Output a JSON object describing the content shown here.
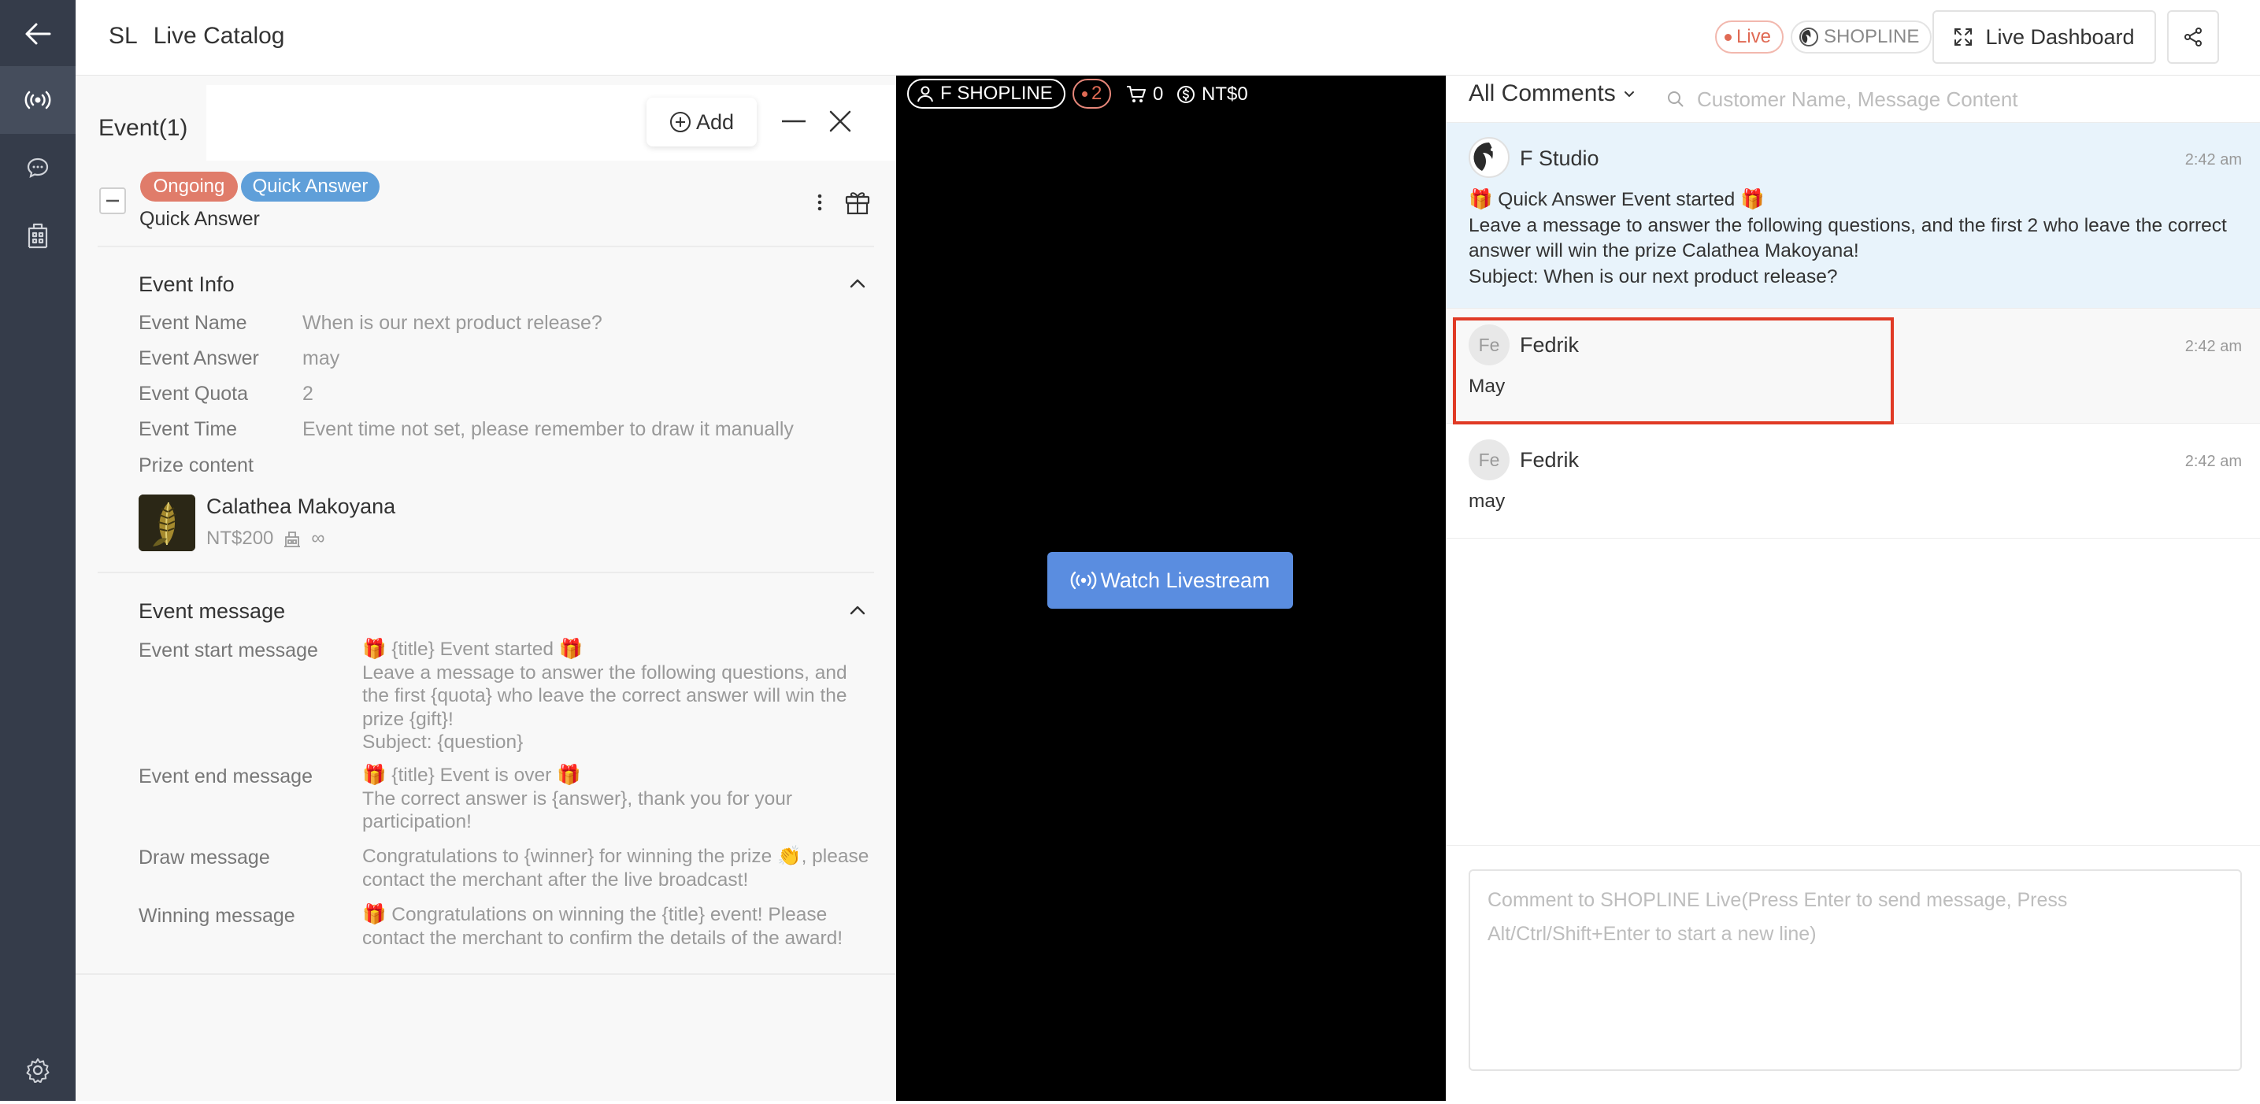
{
  "header": {
    "app_code": "SL",
    "app_title": "Live Catalog",
    "live_badge": "Live",
    "brand_badge": "SHOPLINE",
    "dashboard_button": "Live Dashboard"
  },
  "event_panel": {
    "tab_label": "Event(1)",
    "add_button": "Add",
    "event": {
      "status_tag": "Ongoing",
      "type_tag": "Quick Answer",
      "type_name": "Quick Answer",
      "info_section_title": "Event Info",
      "fields": [
        {
          "label": "Event Name",
          "value": "When is our next product release?"
        },
        {
          "label": "Event Answer",
          "value": "may"
        },
        {
          "label": "Event Quota",
          "value": "2"
        },
        {
          "label": "Event Time",
          "value": "Event time not set, please remember to draw it manually"
        }
      ],
      "prize_label": "Prize content",
      "prize": {
        "name": "Calathea Makoyana",
        "price": "NT$200",
        "stock": "∞"
      },
      "message_section_title": "Event message",
      "messages": [
        {
          "label": "Event start message",
          "text": "🎁 {title} Event started 🎁\nLeave a message to answer the following questions, and the first {quota} who leave the correct answer will win the prize {gift}!\nSubject: {question}"
        },
        {
          "label": "Event end message",
          "text": "🎁 {title} Event is over 🎁\nThe correct answer is {answer}, thank you for your participation!"
        },
        {
          "label": "Draw message",
          "text": "Congratulations to {winner} for winning the prize 👏, please contact the merchant after the live broadcast!"
        },
        {
          "label": "Winning message",
          "text": "🎁 Congratulations on winning the {title} event! Please contact the merchant to confirm the details of the award!"
        }
      ]
    }
  },
  "video": {
    "host_name": "F SHOPLINE",
    "viewer_count": "2",
    "cart_count": "0",
    "sales_amount": "NT$0",
    "watch_button": "Watch Livestream"
  },
  "comments": {
    "filter_label": "All Comments",
    "search_placeholder": "Customer Name, Message Content",
    "items": [
      {
        "author": "F Studio",
        "time": "2:42 am",
        "message": "🎁 Quick Answer Event started 🎁\nLeave a message to answer the following questions, and the first 2 who leave the correct answer will win the prize Calathea Makoyana!\nSubject: When is our next product release?"
      },
      {
        "author": "Fedrik",
        "avatar_initials": "Fe",
        "time": "2:42 am",
        "message": "May"
      },
      {
        "author": "Fedrik",
        "avatar_initials": "Fe",
        "time": "2:42 am",
        "message": "may"
      }
    ],
    "composer_placeholder": "Comment to SHOPLINE Live(Press Enter to send message, Press Alt/Ctrl/Shift+Enter to start a new line)"
  },
  "colors": {
    "rail": "#353c4a",
    "live": "#e06a54",
    "ongoing_tag": "#e07c6a",
    "quick_answer_tag": "#5f9fd9",
    "watch_button": "#5a8de0",
    "highlight_comment": "#e8f3fb",
    "annotation_box": "#e03a25"
  }
}
